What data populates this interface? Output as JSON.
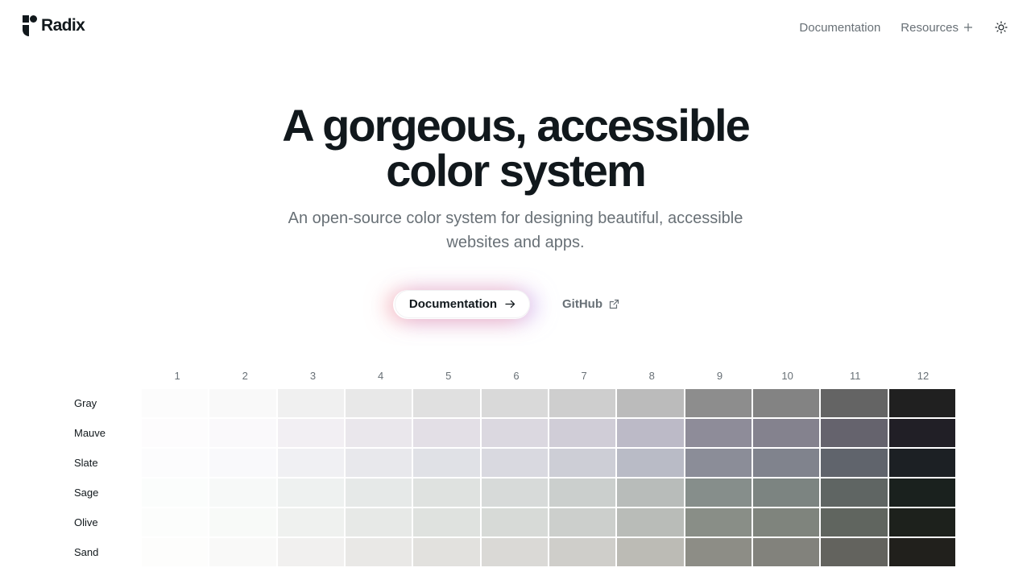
{
  "header": {
    "brand": "Radix",
    "nav": {
      "documentation": "Documentation",
      "resources": "Resources"
    },
    "icons": {
      "logo": "radix-logo-icon",
      "plus": "plus-icon",
      "theme": "sun-icon"
    }
  },
  "hero": {
    "title_line1": "A gorgeous, accessible",
    "title_line2": "color system",
    "subtitle_line1": "An open-source color system for designing beautiful, accessible",
    "subtitle_line2": "websites and apps.",
    "primary_cta": "Documentation",
    "secondary_cta": "GitHub"
  },
  "scale": {
    "steps": [
      "1",
      "2",
      "3",
      "4",
      "5",
      "6",
      "7",
      "8",
      "9",
      "10",
      "11",
      "12"
    ],
    "rows": [
      {
        "name": "Gray",
        "colors": [
          "#fcfcfc",
          "#f9f9f9",
          "#f0f0f0",
          "#e8e8e8",
          "#e0e0e0",
          "#d9d9d9",
          "#cecece",
          "#bbbbbb",
          "#8d8d8d",
          "#838383",
          "#646464",
          "#202020"
        ]
      },
      {
        "name": "Mauve",
        "colors": [
          "#fdfcfd",
          "#faf9fb",
          "#f2eff3",
          "#eae7ec",
          "#e3dfe6",
          "#dbd8e0",
          "#d0cdd7",
          "#bcbac7",
          "#8e8c99",
          "#84828e",
          "#65636d",
          "#211f26"
        ]
      },
      {
        "name": "Slate",
        "colors": [
          "#fcfcfd",
          "#f9f9fb",
          "#f0f0f3",
          "#e8e8ec",
          "#e0e1e6",
          "#d9d9e0",
          "#cdced6",
          "#b9bbc6",
          "#8b8d98",
          "#80838d",
          "#60646c",
          "#1c2024"
        ]
      },
      {
        "name": "Sage",
        "colors": [
          "#fbfdfc",
          "#f7f9f8",
          "#eef1f0",
          "#e6e9e8",
          "#dfe2e0",
          "#d7dad9",
          "#cbcfcd",
          "#b8bcba",
          "#868e8b",
          "#7c8481",
          "#5f6563",
          "#1a211e"
        ]
      },
      {
        "name": "Olive",
        "colors": [
          "#fcfdfc",
          "#f8faf8",
          "#eff1ef",
          "#e7e9e7",
          "#dfe2df",
          "#d7dad7",
          "#cccfcc",
          "#b9bcb8",
          "#898e87",
          "#7f847d",
          "#60655f",
          "#1d211c"
        ]
      },
      {
        "name": "Sand",
        "colors": [
          "#fdfdfc",
          "#f9f9f8",
          "#f1f0ef",
          "#e9e8e6",
          "#e2e1de",
          "#dad9d6",
          "#cfceca",
          "#bcbbb5",
          "#8d8d86",
          "#82827c",
          "#63635e",
          "#21201c"
        ]
      }
    ]
  }
}
